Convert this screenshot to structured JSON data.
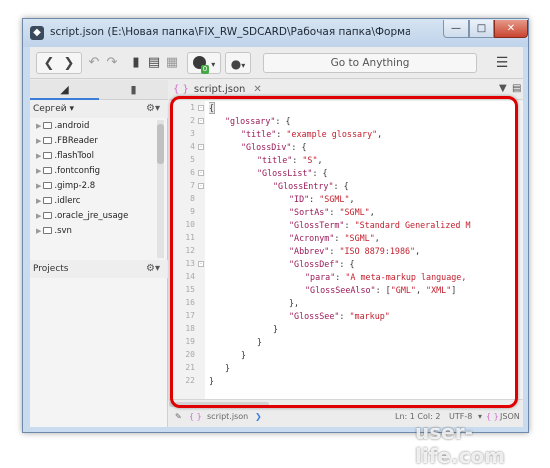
{
  "window": {
    "title": "script.json (E:\\Новая папка\\FIX_RW_SDCARD\\Рабочая папка\\Форматы файлов\\JSON\\Example) - Komodo Ed...",
    "min_label": "—",
    "max_label": "□",
    "close_label": "✕"
  },
  "toolbar": {
    "goto_placeholder": "Go to Anything",
    "badge": "0"
  },
  "sidebar": {
    "section1": "Сергей",
    "section2": "Projects",
    "items": [
      ".android",
      ".FBReader",
      ".flashTool",
      ".fontconfig",
      ".gimp-2.8",
      ".idlerc",
      ".oracle_jre_usage",
      ".svn"
    ]
  },
  "editor": {
    "tab_name": "script.json",
    "lines": [
      "1",
      "2",
      "3",
      "4",
      "5",
      "6",
      "7",
      "8",
      "9",
      "10",
      "11",
      "12",
      "13",
      "14",
      "15",
      "16",
      "17",
      "18",
      "19",
      "20",
      "21",
      "22"
    ],
    "code": {
      "l1": "{",
      "l2k": "\"glossary\"",
      "l2p": ": {",
      "l3k": "\"title\"",
      "l3p": ": ",
      "l3v": "\"example glossary\"",
      "l3e": ",",
      "l4k": "\"GlossDiv\"",
      "l4p": ": {",
      "l5k": "\"title\"",
      "l5p": ": ",
      "l5v": "\"S\"",
      "l5e": ",",
      "l6k": "\"GlossList\"",
      "l6p": ": {",
      "l7k": "\"GlossEntry\"",
      "l7p": ": {",
      "l8k": "\"ID\"",
      "l8p": ": ",
      "l8v": "\"SGML\"",
      "l8e": ",",
      "l9k": "\"SortAs\"",
      "l9p": ": ",
      "l9v": "\"SGML\"",
      "l9e": ",",
      "l10k": "\"GlossTerm\"",
      "l10p": ": ",
      "l10v": "\"Standard Generalized M",
      "l11k": "\"Acronym\"",
      "l11p": ": ",
      "l11v": "\"SGML\"",
      "l11e": ",",
      "l12k": "\"Abbrev\"",
      "l12p": ": ",
      "l12v": "\"ISO 8879:1986\"",
      "l12e": ",",
      "l13k": "\"GlossDef\"",
      "l13p": ": {",
      "l14k": "\"para\"",
      "l14p": ": ",
      "l14v": "\"A meta-markup language,",
      "l15k": "\"GlossSeeAlso\"",
      "l15p": ": [",
      "l15v1": "\"GML\"",
      "l15c": ", ",
      "l15v2": "\"XML\"",
      "l15e": "]",
      "l16": "},",
      "l17k": "\"GlossSee\"",
      "l17p": ": ",
      "l17v": "\"markup\"",
      "l18": "}",
      "l19": "}",
      "l20": "}",
      "l21": "}",
      "l22": "}"
    }
  },
  "status": {
    "file": "script.json",
    "position": "Ln: 1 Col: 2",
    "encoding": "UTF-8",
    "language": "JSON"
  },
  "watermark": "user-life.com"
}
